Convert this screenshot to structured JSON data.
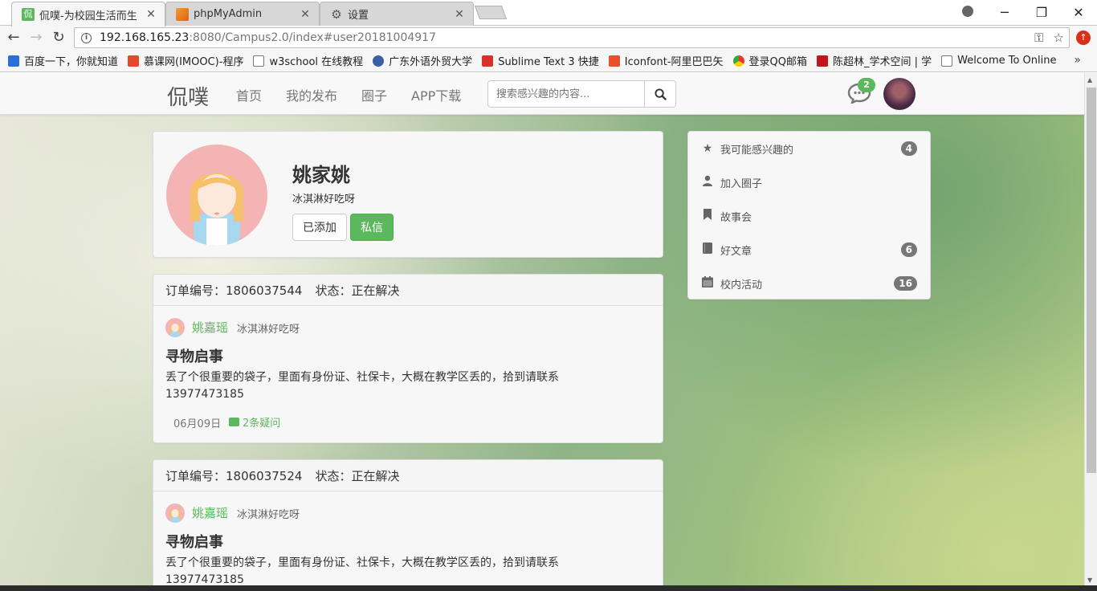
{
  "browser": {
    "tabs": [
      {
        "title": "侃噗-为校园生活而生",
        "icon": "site-favicon"
      },
      {
        "title": "phpMyAdmin",
        "icon": "phpmyadmin-favicon"
      },
      {
        "title": "设置",
        "icon": "gear-icon"
      }
    ],
    "url_host": "192.168.165.23",
    "url_rest": ":8080/Campus2.0/index#user20181004917",
    "bookmarks": [
      "百度一下，你就知道",
      "慕课网(IMOOC)-程序",
      "w3school 在线教程",
      "广东外语外贸大学",
      "Sublime Text 3 快捷",
      "Iconfont-阿里巴巴矢",
      "登录QQ邮箱",
      "陈超林_学术空间 | 学",
      "Welcome To Online"
    ],
    "bookmarks_more": "»"
  },
  "navbar": {
    "brand": "侃噗",
    "links": [
      "首页",
      "我的发布",
      "圈子",
      "APP下载"
    ],
    "search_placeholder": "搜索感兴趣的内容...",
    "message_count": "2"
  },
  "profile": {
    "name": "姚家姚",
    "signature": "冰淇淋好吃呀",
    "added_label": "已添加",
    "message_label": "私信"
  },
  "posts": [
    {
      "order_label": "订单编号：1806037544",
      "status_label": "状态：正在解决",
      "author": "姚嘉瑶",
      "author_sig": "冰淇淋好吃呀",
      "title": "寻物启事",
      "body": "丢了个很重要的袋子，里面有身份证、社保卡，大概在教学区丢的，拾到请联系13977473185",
      "date": "06月09日",
      "comments": "2条疑问"
    },
    {
      "order_label": "订单编号：1806037524",
      "status_label": "状态：正在解决",
      "author": "姚嘉瑶",
      "author_sig": "冰淇淋好吃呀",
      "title": "寻物启事",
      "body": "丢了个很重要的袋子，里面有身份证、社保卡，大概在教学区丢的，拾到请联系13977473185",
      "date": "",
      "comments": ""
    }
  ],
  "sidebar": {
    "items": [
      {
        "label": "我可能感兴趣的",
        "icon": "star-icon",
        "badge": "4"
      },
      {
        "label": "加入圈子",
        "icon": "user-icon",
        "badge": ""
      },
      {
        "label": "故事会",
        "icon": "bookmark-icon",
        "badge": ""
      },
      {
        "label": "好文章",
        "icon": "book-icon",
        "badge": "6"
      },
      {
        "label": "校内活动",
        "icon": "calendar-icon",
        "badge": "16"
      }
    ]
  },
  "colors": {
    "accent_green": "#5cb85c",
    "badge_gray": "#777777"
  }
}
